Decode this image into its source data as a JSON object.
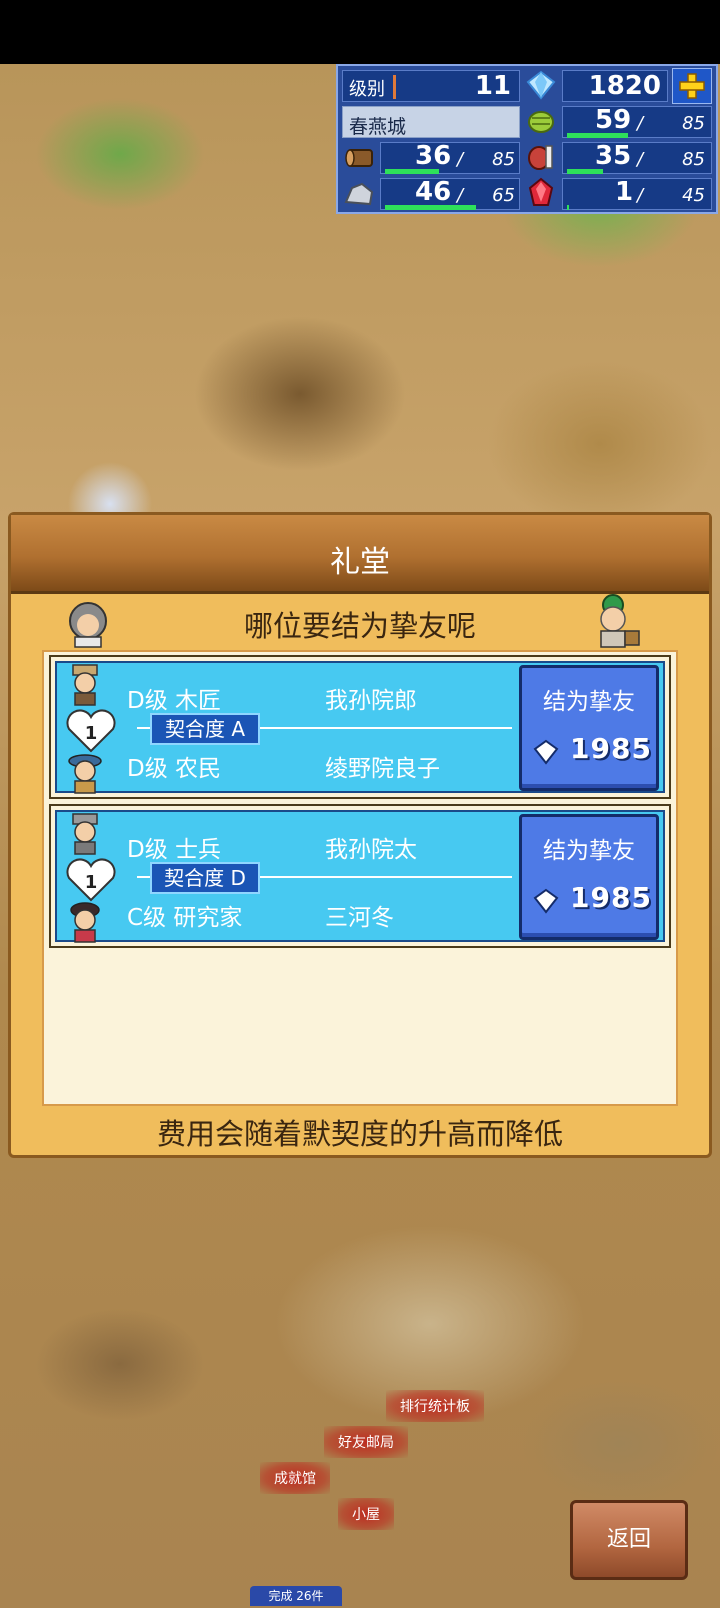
{
  "status": {
    "level_label": "级别",
    "level": "11",
    "gems": "1820",
    "city_name": "春燕城",
    "food": {
      "current": "59",
      "max": "85",
      "fill": 0.69
    },
    "wood": {
      "current": "36",
      "max": "85",
      "fill": 0.42
    },
    "meat": {
      "current": "35",
      "max": "85",
      "fill": 0.41
    },
    "stone": {
      "current": "46",
      "max": "65",
      "fill": 0.71
    },
    "ruby": {
      "current": "1",
      "max": "45",
      "fill": 0.02
    },
    "slash": "/"
  },
  "dialog": {
    "title": "礼堂",
    "prompt": "哪位要结为挚友呢",
    "footer": "费用会随着默契度的升高而降低",
    "rows": [
      {
        "rank1": "D级 木匠",
        "name1": "我孙院郎",
        "rank2": "D级 农民",
        "name2": "绫野院良子",
        "compat": "契合度 A",
        "button_label": "结为挚友",
        "cost": "1985"
      },
      {
        "rank1": "D级 士兵",
        "name1": "我孙院太",
        "rank2": "C级 研究家",
        "name2": "三河冬",
        "compat": "契合度 D",
        "button_label": "结为挚友",
        "cost": "1985"
      }
    ]
  },
  "map_labels": {
    "ranking": "排行统计板",
    "friend_post": "好友邮局",
    "achievements": "成就馆",
    "hut": "小屋"
  },
  "back_label": "返回",
  "complete_label": "完成 26件",
  "colors": {
    "panel_blue": "#2a4c9a",
    "row_cyan": "#47c9f1",
    "button_blue": "#4e7ae6",
    "dialog_gold": "#f0bd5c"
  }
}
